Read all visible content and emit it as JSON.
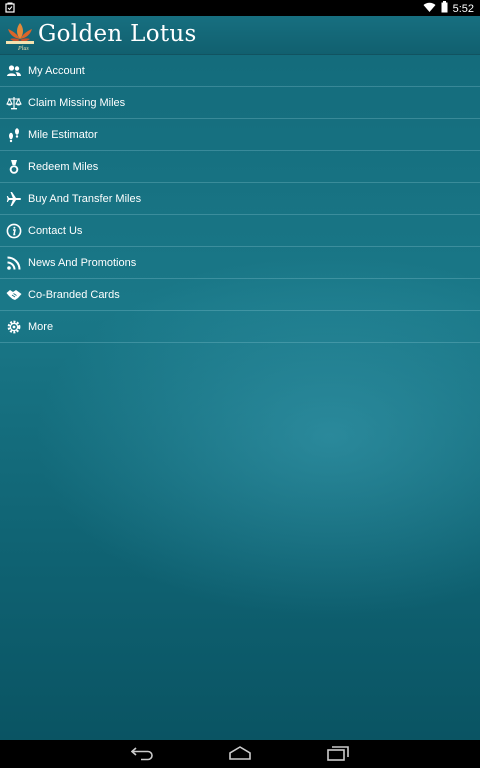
{
  "status_bar": {
    "time": "5:52"
  },
  "header": {
    "title": "Golden Lotus"
  },
  "menu": {
    "items": [
      {
        "label": "My Account",
        "icon": "people-icon"
      },
      {
        "label": "Claim Missing Miles",
        "icon": "scale-icon"
      },
      {
        "label": "Mile Estimator",
        "icon": "footprints-icon"
      },
      {
        "label": "Redeem Miles",
        "icon": "medal-icon"
      },
      {
        "label": "Buy And Transfer Miles",
        "icon": "airplane-icon"
      },
      {
        "label": "Contact Us",
        "icon": "info-icon"
      },
      {
        "label": "News And Promotions",
        "icon": "rss-icon"
      },
      {
        "label": "Co-Branded Cards",
        "icon": "handshake-icon"
      },
      {
        "label": "More",
        "icon": "gear-icon"
      }
    ]
  },
  "colors": {
    "background": "#136a7a",
    "header": "#176f80",
    "divider": "#8fc9d3"
  }
}
